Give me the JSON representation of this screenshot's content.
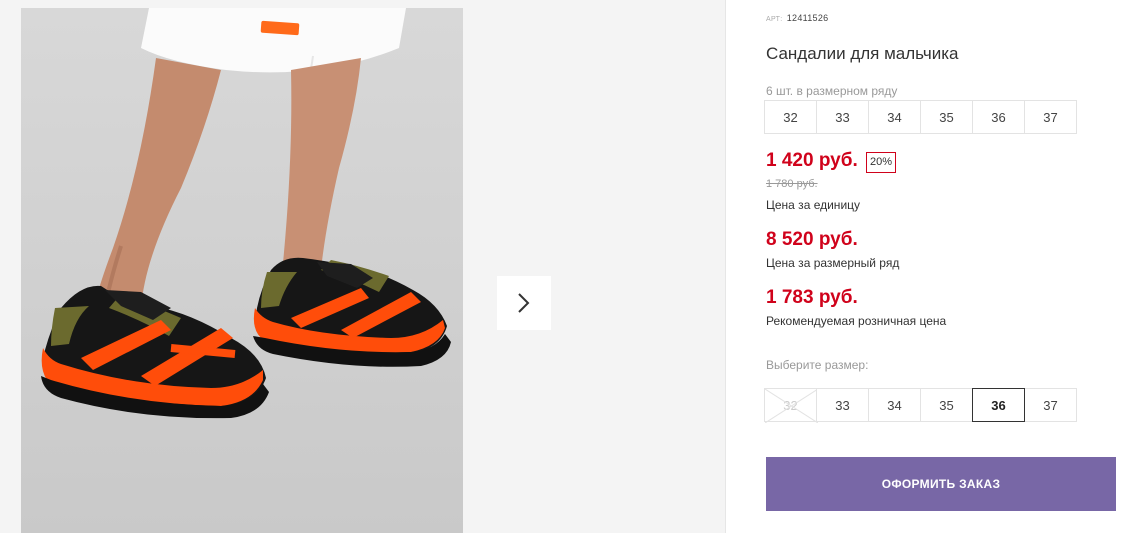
{
  "product": {
    "article_label": "АРТ:",
    "article_value": "12411526",
    "title": "Сандалии для мальчика"
  },
  "pack": {
    "note": "6 шт. в размерном ряду",
    "sizes": [
      "32",
      "33",
      "34",
      "35",
      "36",
      "37"
    ]
  },
  "pricing": {
    "unit_price": "1 420 руб.",
    "discount": "20%",
    "old_price": "1 780 руб.",
    "unit_label": "Цена за единицу",
    "pack_price": "8 520 руб.",
    "pack_label": "Цена за размерный ряд",
    "rrp": "1 783 руб.",
    "rrp_label": "Рекомендуемая розничная цена"
  },
  "size_select": {
    "label": "Выберите размер:",
    "sizes": [
      "32",
      "33",
      "34",
      "35",
      "36",
      "37"
    ],
    "selected": "36",
    "unavailable": [
      "32"
    ]
  },
  "order_button": "ОФОРМИТЬ ЗАКАЗ",
  "colors": {
    "price_red": "#d0021b",
    "button_purple": "#7867a6",
    "sandal_orange": "#ff4d0a",
    "sandal_olive": "#6b6a2e"
  },
  "icons": {
    "next": "chevron-right-icon"
  }
}
